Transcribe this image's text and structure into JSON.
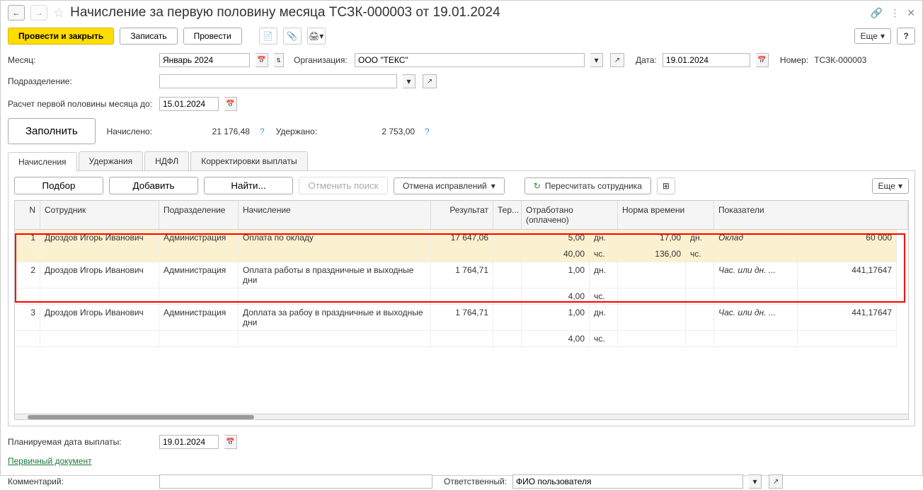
{
  "header": {
    "title": "Начисление за первую половину месяца ТСЗК-000003 от 19.01.2024"
  },
  "cmd": {
    "post_close": "Провести и закрыть",
    "save": "Записать",
    "post": "Провести",
    "more": "Еще",
    "help": "?"
  },
  "form": {
    "month_label": "Месяц:",
    "month_value": "Январь 2024",
    "org_label": "Организация:",
    "org_value": "ООО \"ТЕКС\"",
    "date_label": "Дата:",
    "date_value": "19.01.2024",
    "num_label": "Номер:",
    "num_value": "ТСЗК-000003",
    "dept_label": "Подразделение:",
    "dept_value": "",
    "calc_label": "Расчет первой половины месяца до:",
    "calc_value": "15.01.2024",
    "fill": "Заполнить",
    "accrued_label": "Начислено:",
    "accrued_value": "21 176,48",
    "withheld_label": "Удержано:",
    "withheld_value": "2 753,00"
  },
  "tabs": {
    "t1": "Начисления",
    "t2": "Удержания",
    "t3": "НДФЛ",
    "t4": "Корректировки выплаты"
  },
  "subcmd": {
    "pick": "Подбор",
    "add": "Добавить",
    "find": "Найти...",
    "cancel_search": "Отменить поиск",
    "cancel_fix": "Отмена исправлений",
    "recalc": "Пересчитать сотрудника",
    "more": "Еще"
  },
  "grid": {
    "h_n": "N",
    "h_emp": "Сотрудник",
    "h_dept": "Подразделение",
    "h_acc": "Начисление",
    "h_res": "Результат",
    "h_ter": "Тер...",
    "h_wk": "Отработано (оплачено)",
    "h_norm": "Норма времени",
    "h_ind": "Показатели",
    "rows": [
      {
        "n": "1",
        "emp": "Дроздов Игорь Иванович",
        "dept": "Администрация",
        "acc": "Оплата по окладу",
        "res": "17 647,06",
        "wkd": "5,00",
        "wku": "дн.",
        "nrm": "17,00",
        "nru": "дн.",
        "ind": "Оклад",
        "iv": "60 000",
        "wkd2": "40,00",
        "wku2": "чс.",
        "nrm2": "136,00",
        "nru2": "чс."
      },
      {
        "n": "2",
        "emp": "Дроздов Игорь Иванович",
        "dept": "Администрация",
        "acc": "Оплата работы в праздничные и выходные дни",
        "res": "1 764,71",
        "wkd": "1,00",
        "wku": "дн.",
        "ind": "Час. или дн. ...",
        "iv": "441,17647",
        "wkd2": "4,00",
        "wku2": "чс."
      },
      {
        "n": "3",
        "emp": "Дроздов Игорь Иванович",
        "dept": "Администрация",
        "acc": "Доплата за рабоу в праздничные и выходные дни",
        "res": "1 764,71",
        "wkd": "1,00",
        "wku": "дн.",
        "ind": "Час. или дн. ...",
        "iv": "441,17647",
        "wkd2": "4,00",
        "wku2": "чс."
      }
    ]
  },
  "footer": {
    "plan_label": "Планируемая дата выплаты:",
    "plan_value": "19.01.2024",
    "primary_doc": "Первичный документ",
    "comment_label": "Комментарий:",
    "comment_value": "",
    "resp_label": "Ответственный:",
    "resp_value": "ФИО пользователя"
  }
}
